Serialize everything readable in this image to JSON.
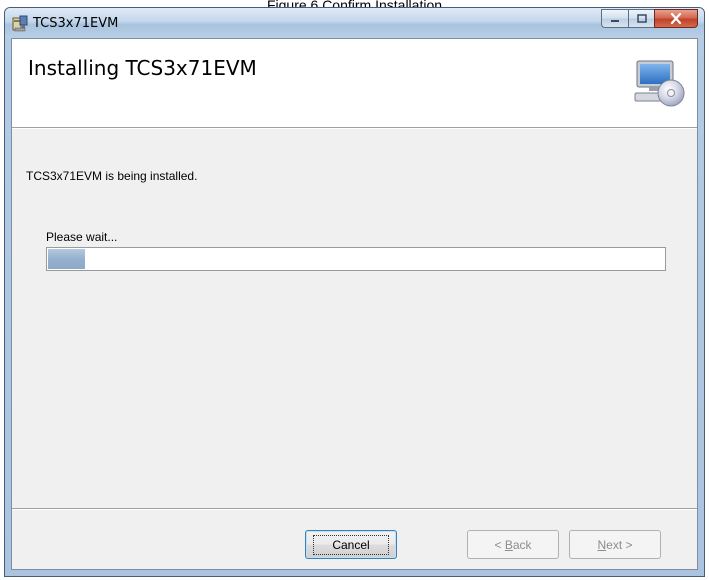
{
  "caption": "Figure 6 Confirm Installation",
  "window": {
    "title": "TCS3x71EVM"
  },
  "banner": {
    "title": "Installing TCS3x71EVM"
  },
  "status": {
    "message": "TCS3x71EVM is being installed.",
    "wait_label": "Please wait...",
    "progress_percent": 6
  },
  "buttons": {
    "cancel": "Cancel",
    "back_prefix": "< ",
    "back_accel": "B",
    "back_rest": "ack",
    "next_accel": "N",
    "next_rest": "ext >"
  },
  "icons": {
    "app": "installer-icon",
    "banner": "computer-disc-icon"
  },
  "colors": {
    "progress_fill": "#95b0cf",
    "close_button": "#c1422a"
  }
}
